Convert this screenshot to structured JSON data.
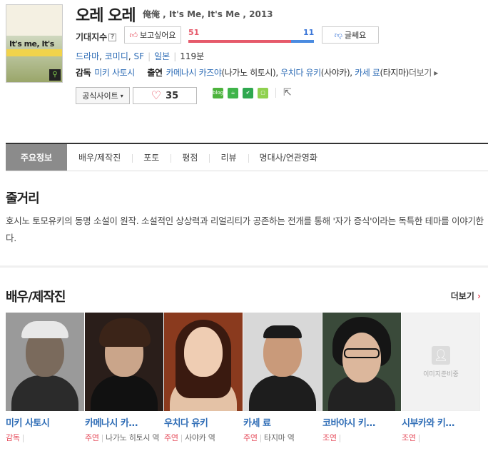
{
  "movie": {
    "title": "오레 오레",
    "subtitle": "俺俺 , It's Me, It's Me , 2013",
    "poster": {
      "title_text": "It's me, It's me"
    },
    "expect": {
      "label": "기대지수",
      "want_label": "보고싶어요",
      "notwant_label": "글쎄요",
      "want_count": "51",
      "notwant_count": "11",
      "want_ratio": 0.82
    },
    "genres": [
      "드라마",
      "코미디",
      "SF"
    ],
    "country": "일본",
    "runtime": "119분",
    "director_label": "감독",
    "director": "미키 사토시",
    "cast_label": "출연",
    "cast_line": [
      {
        "name": "카메나시 카즈야",
        "role": "(나가노 히토시),"
      },
      {
        "name": "우치다 유키",
        "role": "(사야카),"
      },
      {
        "name": "카세 료",
        "role": "(타지마)"
      }
    ],
    "more_label": "더보기",
    "site_label": "공식사이트",
    "like_count": "35"
  },
  "tabs": [
    {
      "label": "주요정보",
      "active": true
    },
    {
      "label": "배우/제작진"
    },
    {
      "label": "포토"
    },
    {
      "label": "평점"
    },
    {
      "label": "리뷰"
    },
    {
      "label": "명대사/연관영화"
    }
  ],
  "synopsis": {
    "heading": "줄거리",
    "text": "호시노 토모유키의 동명 소설이 원작. 소설적인 상상력과 리얼리티가 공존하는 전개를 통해 '자가 증식'이라는 독특한 테마를 이야기한다."
  },
  "cast_section": {
    "heading": "배우/제작진",
    "more_label": "더보기",
    "no_image_text": "이미지준비중",
    "people": [
      {
        "name": "미키 사토시",
        "type": "감독",
        "role": ""
      },
      {
        "name": "카메나시 카…",
        "type": "주연",
        "role": "나가노 히토시 역"
      },
      {
        "name": "우치다 유키",
        "type": "주연",
        "role": "사야카 역"
      },
      {
        "name": "카세 료",
        "type": "주연",
        "role": "타지마 역"
      },
      {
        "name": "코바야시 키…",
        "type": "조연",
        "role": ""
      },
      {
        "name": "시부카와 키…",
        "type": "조연",
        "role": ""
      }
    ]
  },
  "colors": {
    "accent": "#e64d5c",
    "link": "#2f6db6",
    "tab_active": "#8b8b8b"
  }
}
